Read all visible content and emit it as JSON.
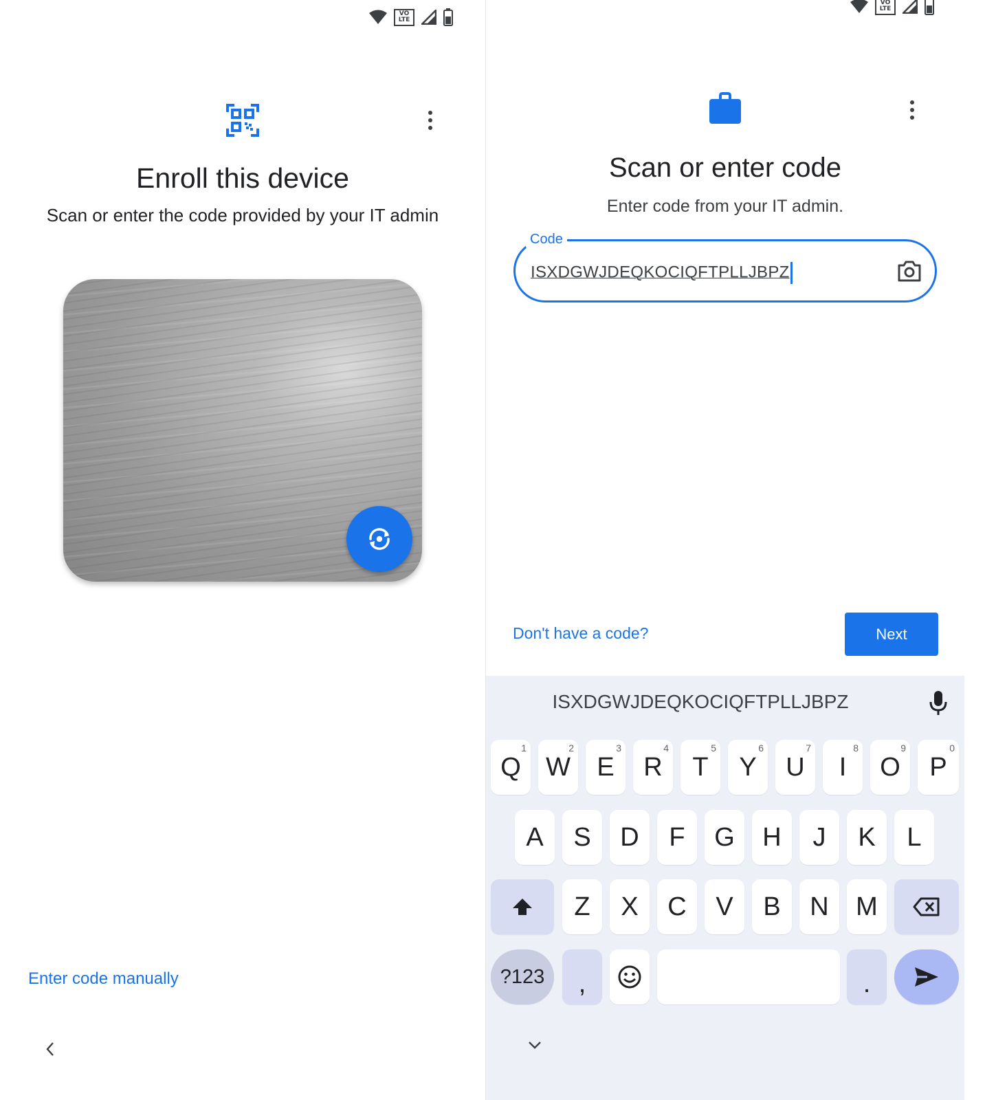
{
  "left_screen": {
    "header_title": "Enroll this device",
    "subtitle": "Scan or enter the code provided by your IT admin",
    "enter_manually_label": "Enter code manually"
  },
  "right_screen": {
    "title": "Scan or enter code",
    "subtitle": "Enter code from your IT admin.",
    "code_field": {
      "label": "Code",
      "value": "ISXDGWJDEQKOCIQFTPLLJBPZ"
    },
    "no_code_link": "Don't have a code?",
    "next_button": "Next"
  },
  "keyboard": {
    "suggestion": "ISXDGWJDEQKOCIQFTPLLJBPZ",
    "row1": [
      "Q",
      "W",
      "E",
      "R",
      "T",
      "Y",
      "U",
      "I",
      "O",
      "P"
    ],
    "row1_hints": [
      "1",
      "2",
      "3",
      "4",
      "5",
      "6",
      "7",
      "8",
      "9",
      "0"
    ],
    "row2": [
      "A",
      "S",
      "D",
      "F",
      "G",
      "H",
      "J",
      "K",
      "L"
    ],
    "row3": [
      "Z",
      "X",
      "C",
      "V",
      "B",
      "N",
      "M"
    ],
    "symbols_key": "?123",
    "comma_key": ",",
    "period_key": "."
  },
  "colors": {
    "accent": "#1a73e8",
    "keyboard_bg": "#eef0f8",
    "special_key": "#d8dcf3"
  },
  "icons": {
    "status": [
      "wifi-icon",
      "volte-icon",
      "signal-icon",
      "battery-icon"
    ],
    "left_header": "qr-code-icon",
    "right_header": "briefcase-icon",
    "fab": "switch-camera-icon",
    "field_trailing": "camera-icon"
  }
}
